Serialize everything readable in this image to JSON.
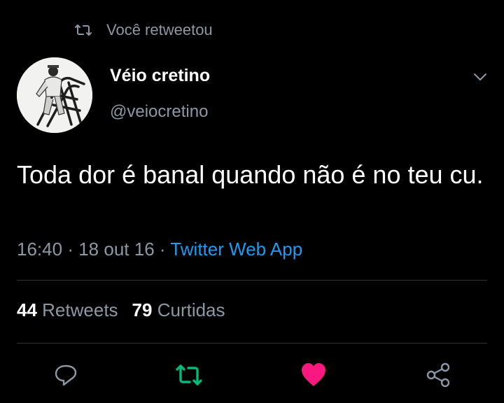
{
  "retweet_context": {
    "text": "Você retweetou",
    "icon": "retweet-icon"
  },
  "author": {
    "display_name": "Véio cretino",
    "handle": "@veiocretino",
    "avatar": "avatar-photo"
  },
  "tweet": {
    "text": "Toda dor é banal quando não é no teu cu.",
    "time": "16:40",
    "date": "18 out 16",
    "separator": "·",
    "client": "Twitter Web App"
  },
  "stats": {
    "retweets_count": "44",
    "retweets_label": "Retweets",
    "likes_count": "79",
    "likes_label": "Curtidas"
  },
  "actions": [
    {
      "name": "reply",
      "icon": "reply-icon"
    },
    {
      "name": "retweet",
      "icon": "retweet-icon",
      "active": true
    },
    {
      "name": "like",
      "icon": "heart-icon",
      "active": true
    },
    {
      "name": "share",
      "icon": "share-icon"
    }
  ],
  "colors": {
    "background": "#000000",
    "text": "#ffffff",
    "secondary": "#8b98a5",
    "link": "#1d9bf0",
    "retweet_active": "#00ba7c",
    "like_active": "#f91880",
    "divider": "#2f3336"
  }
}
